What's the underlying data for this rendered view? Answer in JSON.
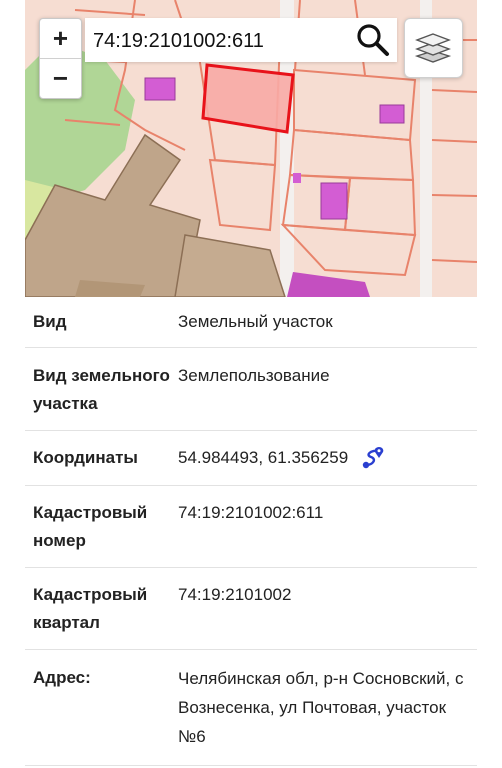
{
  "map": {
    "zoom_in_label": "+",
    "zoom_out_label": "−",
    "search_value": "74:19:2101002:611",
    "search_icon": "search-icon",
    "layers_icon": "layers-icon",
    "selected_parcel_color": "#e8121a",
    "building_color": "#d35dd3"
  },
  "details": {
    "rows": [
      {
        "label": "Вид",
        "value": "Земельный участок"
      },
      {
        "label": "Вид земельного участка",
        "value": "Землепользование"
      },
      {
        "label": "Координаты",
        "value": "54.984493, 61.356259",
        "icon": "route-icon"
      },
      {
        "label": "Кадастровый номер",
        "value": "74:19:2101002:611"
      },
      {
        "label": "Кадастровый квартал",
        "value": "74:19:2101002"
      },
      {
        "label": "Адрес:",
        "value": "Челябинская обл, р-н Сосновский, с Вознесенка, ул Почтовая, участок №6"
      }
    ]
  }
}
